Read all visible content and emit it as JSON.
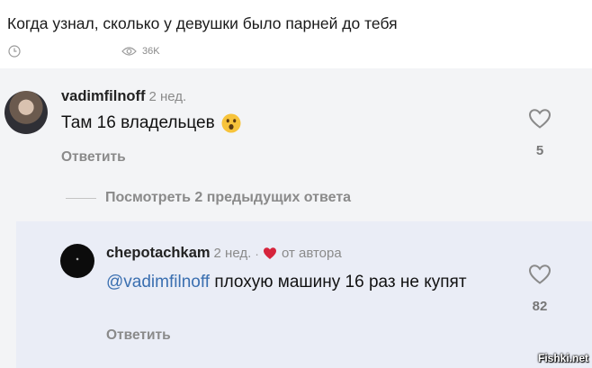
{
  "post": {
    "title": "Когда узнал, сколько у девушки было парней до тебя",
    "views": "36K"
  },
  "comments": [
    {
      "username": "vadimfilnoff",
      "ago": "2 нед.",
      "text": "Там 16 владельцев",
      "emoji": "astonished-face",
      "reply_label": "Ответить",
      "likes": "5"
    },
    {
      "username": "chepotachkam",
      "ago": "2 нед.",
      "author_label": "от автора",
      "mention": "@vadimfilnoff",
      "text": " плохую машину 16 раз не купят",
      "reply_label": "Ответить",
      "likes": "82"
    }
  ],
  "show_more": "Посмотреть 2 предыдущих ответа",
  "watermark": "Fishki.net",
  "colors": {
    "mention": "#3a6fb0",
    "author_heart": "#d6243c",
    "reply_bg": "#eaedf6"
  }
}
